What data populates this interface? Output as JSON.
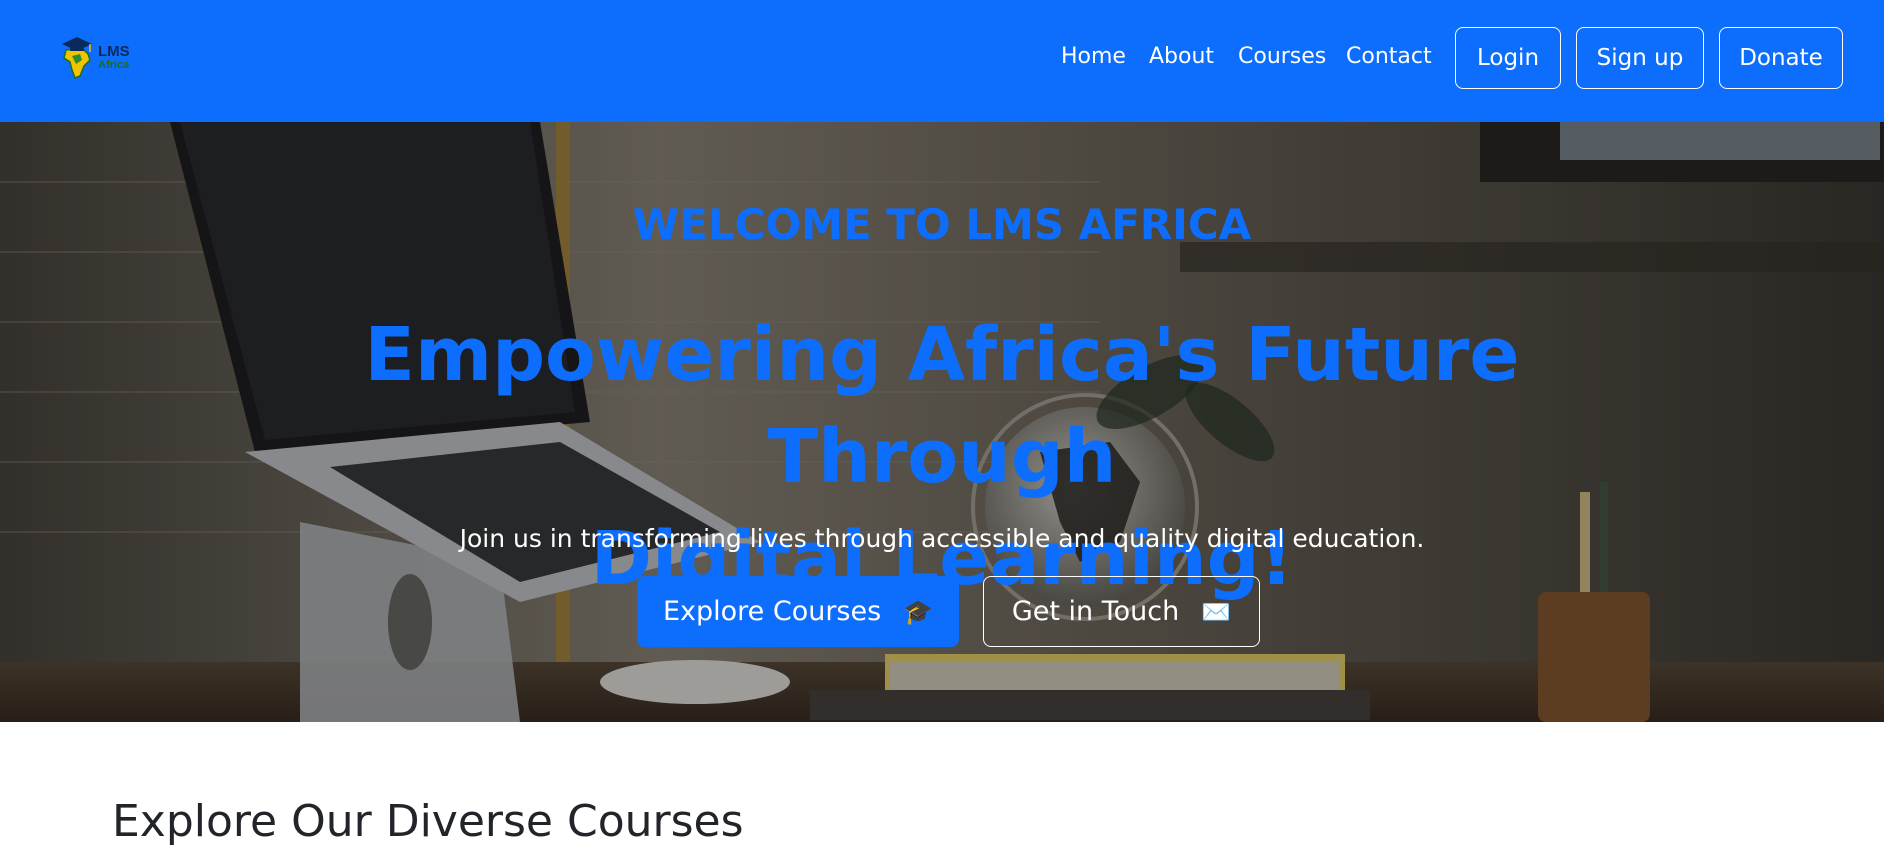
{
  "brand": {
    "logo_line1": "LMS",
    "logo_line2": "Africa",
    "icon": "graduation-cap-africa-icon"
  },
  "nav": {
    "links": [
      {
        "label": "Home"
      },
      {
        "label": "About"
      },
      {
        "label": "Courses"
      },
      {
        "label": "Contact"
      }
    ],
    "buttons": [
      {
        "label": "Login"
      },
      {
        "label": "Sign up"
      },
      {
        "label": "Donate"
      }
    ]
  },
  "hero": {
    "eyebrow": "WELCOME TO LMS AFRICA",
    "title_line1": "Empowering Africa's Future Through",
    "title_line2": "Digital Learning!",
    "subtitle": "Join us in transforming lives through accessible and quality digital education.",
    "primary_button": {
      "label": "Explore Courses",
      "icon": "🎓"
    },
    "secondary_button": {
      "label": "Get in Touch",
      "icon": "✉️"
    }
  },
  "section": {
    "title": "Explore Our Diverse Courses"
  },
  "colors": {
    "primary": "#0d6efd",
    "text_dark": "#212529",
    "white": "#ffffff"
  }
}
